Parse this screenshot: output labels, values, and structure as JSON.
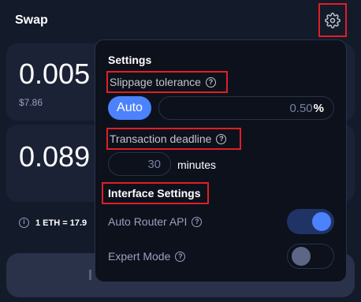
{
  "header": {
    "title": "Swap",
    "settings_icon": "gear-icon"
  },
  "input_card": {
    "amount": "0.005",
    "usd_value": "$7.86"
  },
  "output_card": {
    "amount": "0.089"
  },
  "rate": {
    "text": "1 ETH = 17.9"
  },
  "swap_button": {
    "label": "I"
  },
  "settings": {
    "title": "Settings",
    "slippage": {
      "label": "Slippage tolerance",
      "auto_label": "Auto",
      "value": "0.50",
      "unit": "%"
    },
    "deadline": {
      "label": "Transaction deadline",
      "value": "30",
      "unit": "minutes"
    },
    "interface": {
      "title": "Interface Settings",
      "auto_router": {
        "label": "Auto Router API",
        "enabled": true
      },
      "expert_mode": {
        "label": "Expert Mode",
        "enabled": false
      }
    }
  },
  "colors": {
    "accent": "#4c82fb",
    "highlight": "#e01f26",
    "background": "#131a2a"
  }
}
